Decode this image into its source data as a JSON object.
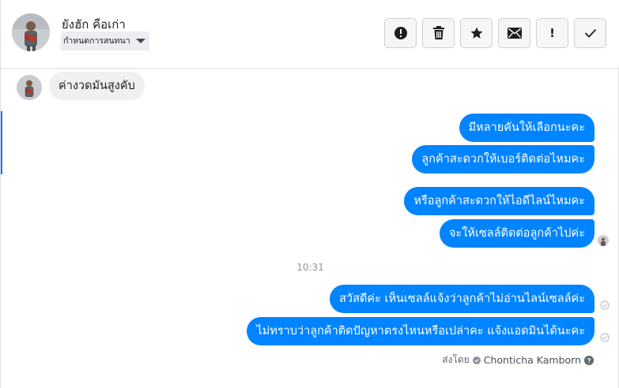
{
  "header": {
    "contact_name": "ยังฮัก คือเก่า",
    "label_select": "กำหนดการสนทนา",
    "actions": [
      {
        "name": "report-spam",
        "icon": "alert-circle-icon"
      },
      {
        "name": "delete",
        "icon": "trash-icon"
      },
      {
        "name": "star",
        "icon": "star-icon"
      },
      {
        "name": "mark-unread",
        "icon": "envelope-icon"
      },
      {
        "name": "flag-followup",
        "icon": "exclamation-icon",
        "glyph": "!"
      },
      {
        "name": "mark-done",
        "icon": "check-icon"
      }
    ]
  },
  "conversation": {
    "incoming": [
      {
        "text": "ค่างวดมันสูงคับ"
      }
    ],
    "outgoing_group_1": [
      {
        "text": "มีหลายคันให้เลือกนะคะ"
      },
      {
        "text": "ลูกค้าสะดวกให้เบอร์ติดต่อไหมคะ"
      }
    ],
    "outgoing_group_2": [
      {
        "text": "หรือลูกค้าสะดวกให้ไอดีไลน์ไหมคะ"
      },
      {
        "text": "จะให้เซลล์ติดต่อลูกค้าไปค่ะ"
      }
    ],
    "timestamp": "10:31",
    "outgoing_group_3": [
      {
        "text": "สวัสดีค่ะ เห็นเซลล์แจ้งว่าลูกค้าไม่อ่านไลน์เซลล์ค่ะ"
      },
      {
        "text": "ไม่ทราบว่าลูกค้าติดปัญหาตรงไหนหรือเปล่าคะ แจ้งแอดมินได้นะคะ"
      }
    ],
    "sent_by_label": "ส่งโดย",
    "sent_by_name": "Chonticha Kamborn"
  },
  "colors": {
    "outgoing_bubble": "#0084ff",
    "incoming_bubble": "#f1f0f0",
    "accent_edge": "#1877f2"
  }
}
